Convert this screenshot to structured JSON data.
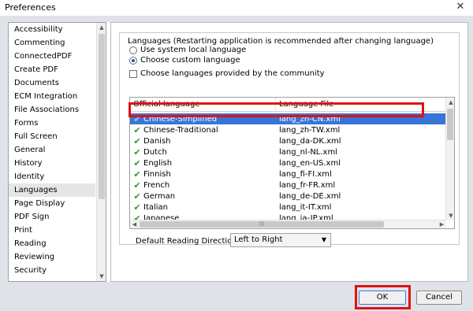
{
  "window": {
    "title": "Preferences",
    "close_glyph": "✕"
  },
  "sidebar": {
    "items": [
      {
        "label": "Accessibility"
      },
      {
        "label": "Commenting"
      },
      {
        "label": "ConnectedPDF"
      },
      {
        "label": "Create PDF"
      },
      {
        "label": "Documents"
      },
      {
        "label": "ECM Integration"
      },
      {
        "label": "File Associations"
      },
      {
        "label": "Forms"
      },
      {
        "label": "Full Screen"
      },
      {
        "label": "General"
      },
      {
        "label": "History"
      },
      {
        "label": "Identity"
      },
      {
        "label": "Languages",
        "selected": true
      },
      {
        "label": "Page Display"
      },
      {
        "label": "PDF Sign"
      },
      {
        "label": "Print"
      },
      {
        "label": "Reading"
      },
      {
        "label": "Reviewing"
      },
      {
        "label": "Security"
      }
    ]
  },
  "languages": {
    "group_title": "Languages (Restarting application is recommended after changing language)",
    "option_system": "Use system local language",
    "option_custom": "Choose custom language",
    "community_label": "Choose languages provided by the community",
    "columns": [
      "Official language",
      "Language File"
    ],
    "rows": [
      {
        "language": "Chinese-Simplified",
        "file": "lang_zh-CN.xml",
        "selected": true
      },
      {
        "language": "Chinese-Traditional",
        "file": "lang_zh-TW.xml"
      },
      {
        "language": "Danish",
        "file": "lang_da-DK.xml"
      },
      {
        "language": "Dutch",
        "file": "lang_nl-NL.xml"
      },
      {
        "language": "English",
        "file": "lang_en-US.xml"
      },
      {
        "language": "Finnish",
        "file": "lang_fi-FI.xml"
      },
      {
        "language": "French",
        "file": "lang_fr-FR.xml"
      },
      {
        "language": "German",
        "file": "lang_de-DE.xml"
      },
      {
        "language": "Italian",
        "file": "lang_it-IT.xml"
      },
      {
        "language": "Japanese",
        "file": "lang_ja-JP.xml"
      }
    ]
  },
  "reading_direction": {
    "label": "Default Reading Direction:",
    "value": "Left to Right"
  },
  "buttons": {
    "ok": "OK",
    "cancel": "Cancel"
  },
  "colors": {
    "selection": "#3875d7",
    "highlight": "#e01212",
    "check": "#2a9a2a"
  }
}
